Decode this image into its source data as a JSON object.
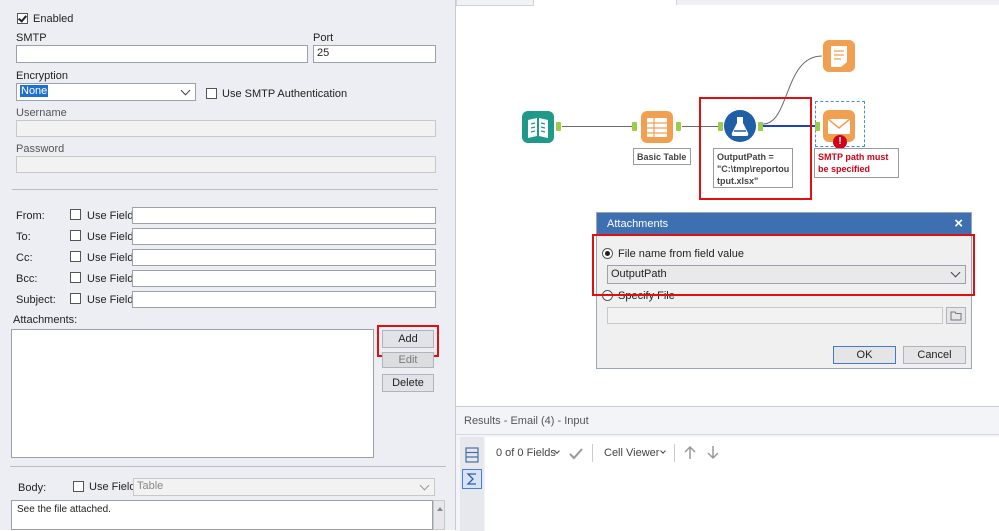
{
  "config": {
    "enabled_label": "Enabled",
    "smtp_label": "SMTP",
    "smtp_value": "",
    "port_label": "Port",
    "port_value": "25",
    "encryption_label": "Encryption",
    "encryption_value": "None",
    "use_smtp_auth_label": "Use SMTP Authentication",
    "username_label": "Username",
    "password_label": "Password",
    "from_label": "From:",
    "to_label": "To:",
    "cc_label": "Cc:",
    "bcc_label": "Bcc:",
    "subject_label": "Subject:",
    "use_field_label": "Use Field",
    "attachments_label": "Attachments:",
    "add_label": "Add",
    "edit_label": "Edit",
    "delete_label": "Delete",
    "body_label": "Body:",
    "body_use_field_label": "Use Field",
    "body_field_select": "Table",
    "body_text": "See the file attached."
  },
  "canvas": {
    "basic_table_caption": "Basic Table",
    "formula_caption_1": "OutputPath =",
    "formula_caption_2": "\"C:\\tmp\\reportou",
    "formula_caption_3": "tput.xlsx\"",
    "error_line_1": "SMTP path must",
    "error_line_2": "be specified",
    "error_icon": "!"
  },
  "dialog": {
    "title": "Attachments",
    "close_glyph": "×",
    "option_field_label": "File name from field value",
    "field_select_value": "OutputPath",
    "option_file_label": "Specify File",
    "file_value": "",
    "ok_label": "OK",
    "cancel_label": "Cancel"
  },
  "results": {
    "title": "Results - Email (4) - Input",
    "fields_label": "0 of 0 Fields",
    "cell_viewer_label": "Cell Viewer"
  },
  "colors": {
    "highlight": "#e01010",
    "dialog_title_bar": "#3d6fb1",
    "error_text": "#d0021b",
    "anchor": "#9ccc4a",
    "tool_orange": "#f0a050",
    "tool_teal": "#1f9a8a",
    "tool_blue": "#1f5fa8"
  }
}
